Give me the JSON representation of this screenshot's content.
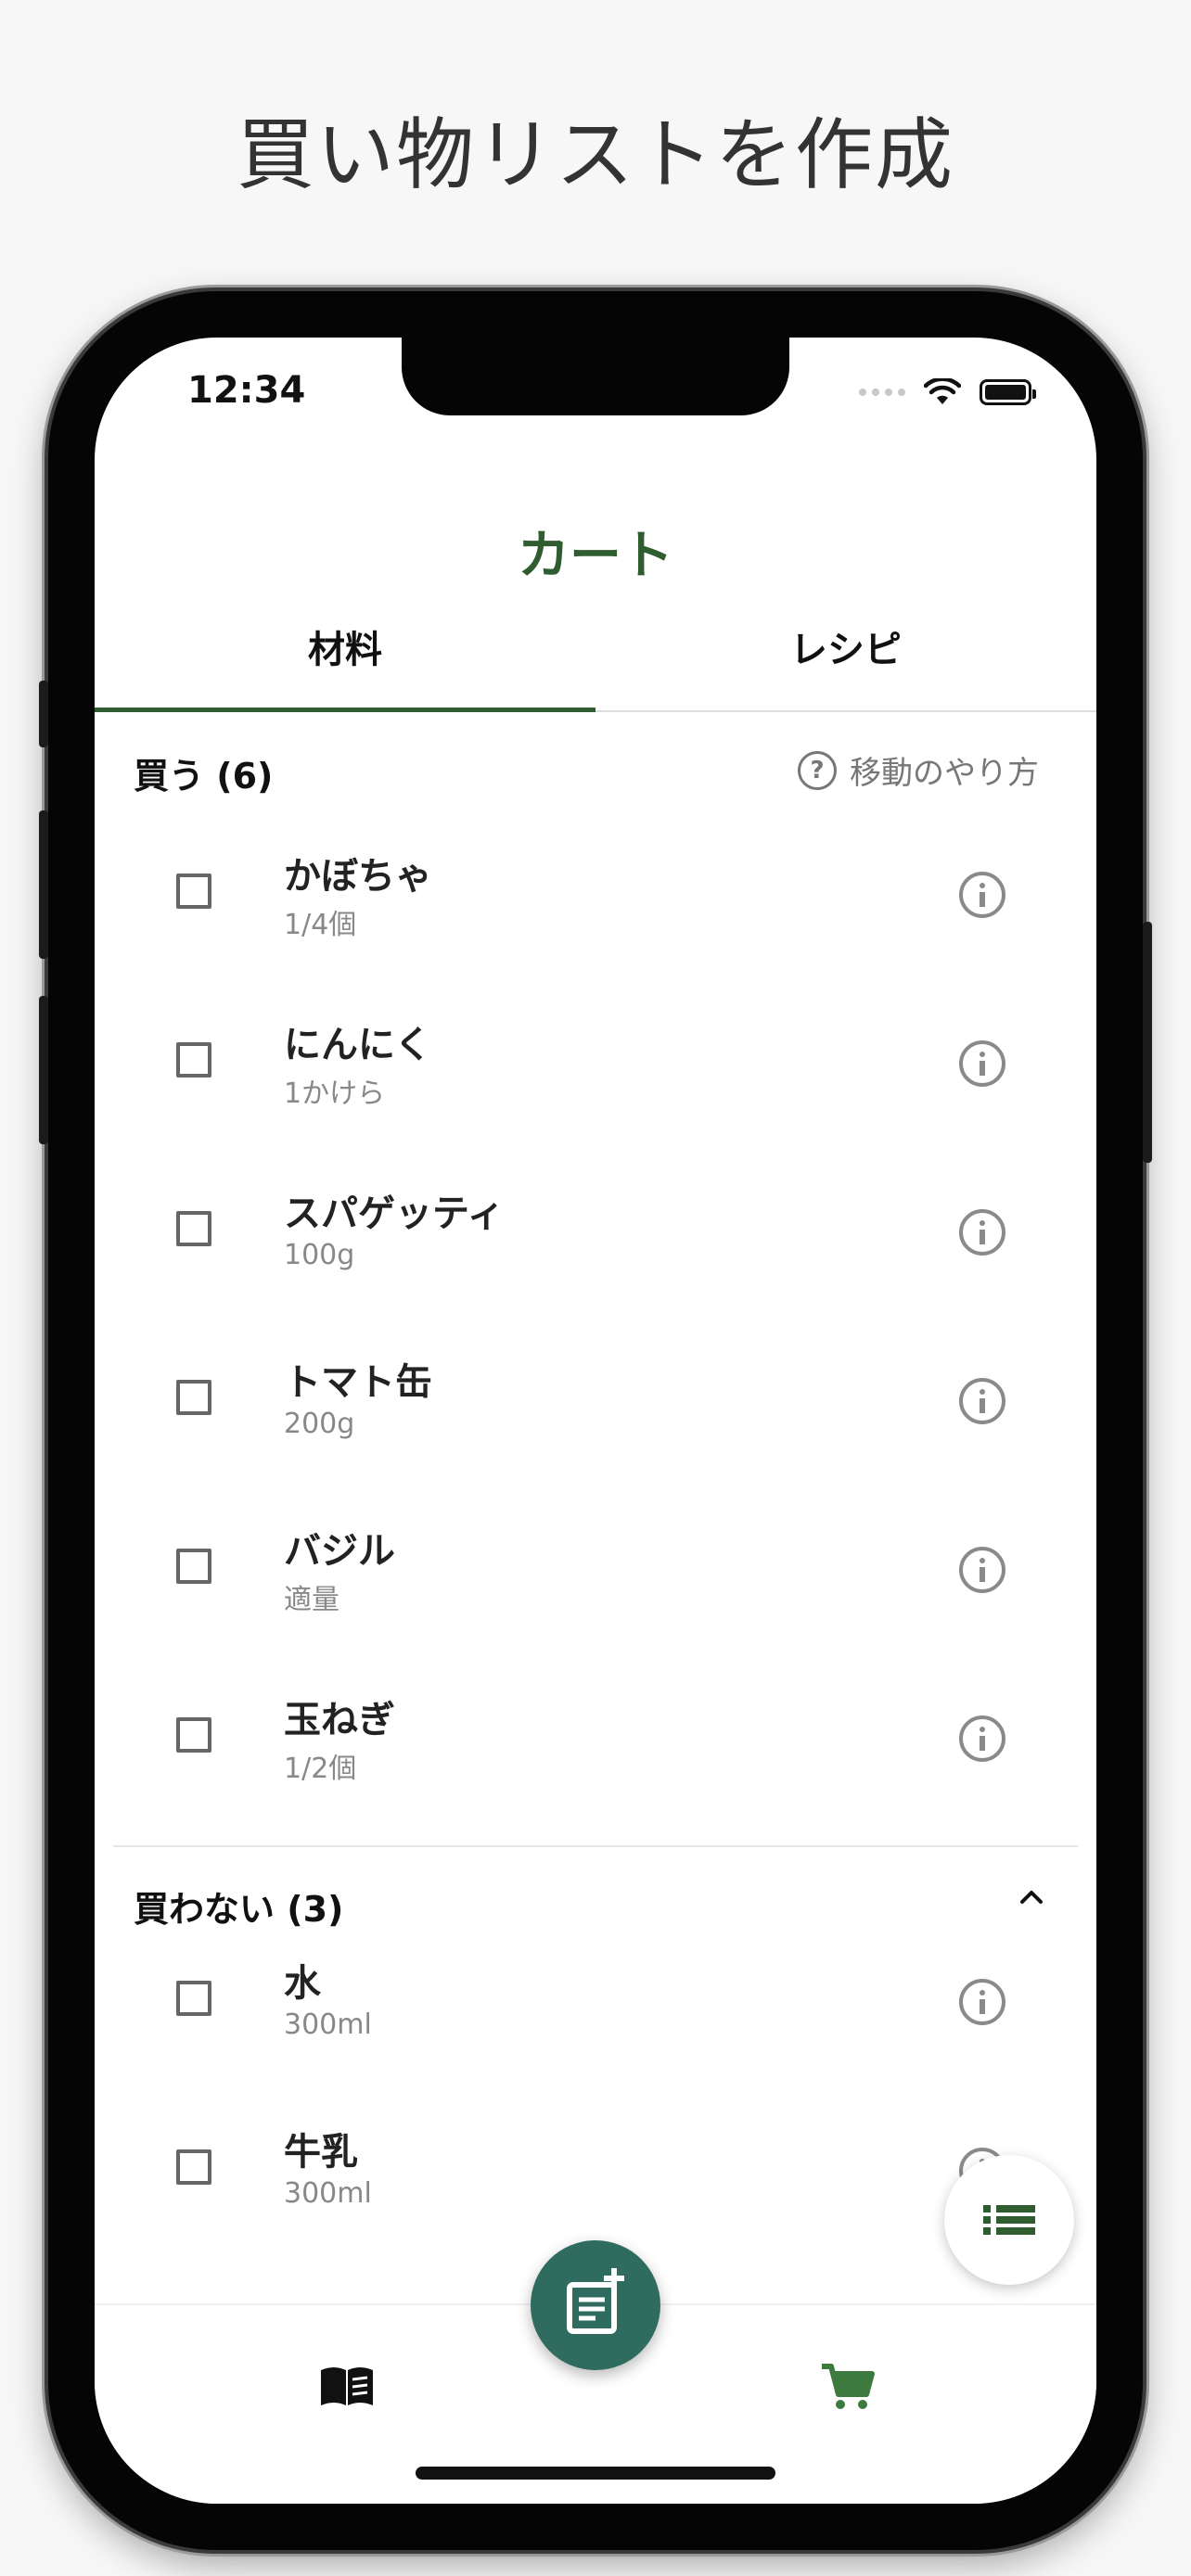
{
  "promo": {
    "title": "買い物リストを作成"
  },
  "status_bar": {
    "time": "12:34"
  },
  "header": {
    "title": "カート"
  },
  "tabs": [
    {
      "label": "材料",
      "active": true
    },
    {
      "label": "レシピ",
      "active": false
    }
  ],
  "buy_section": {
    "title": "買う (6)",
    "howto_label": "移動のやり方",
    "items": [
      {
        "name": "かぼちゃ",
        "qty": "1/4個"
      },
      {
        "name": "にんにく",
        "qty": "1かけら"
      },
      {
        "name": "スパゲッティ",
        "qty": "100g"
      },
      {
        "name": "トマト缶",
        "qty": "200g"
      },
      {
        "name": "バジル",
        "qty": "適量"
      },
      {
        "name": "玉ねぎ",
        "qty": "1/2個"
      }
    ]
  },
  "nobuy_section": {
    "title": "買わない (3)",
    "items": [
      {
        "name": "水",
        "qty": "300ml"
      },
      {
        "name": "牛乳",
        "qty": "300ml"
      }
    ]
  },
  "bottom_nav": {
    "items": [
      {
        "icon": "book-icon",
        "active": false
      },
      {
        "icon": "cart-icon",
        "active": true
      }
    ]
  },
  "colors": {
    "primary_green": "#2f5d2f",
    "fab_teal": "#2f6b5e",
    "cart_green": "#3d7a3d",
    "muted_gray": "#888888"
  }
}
